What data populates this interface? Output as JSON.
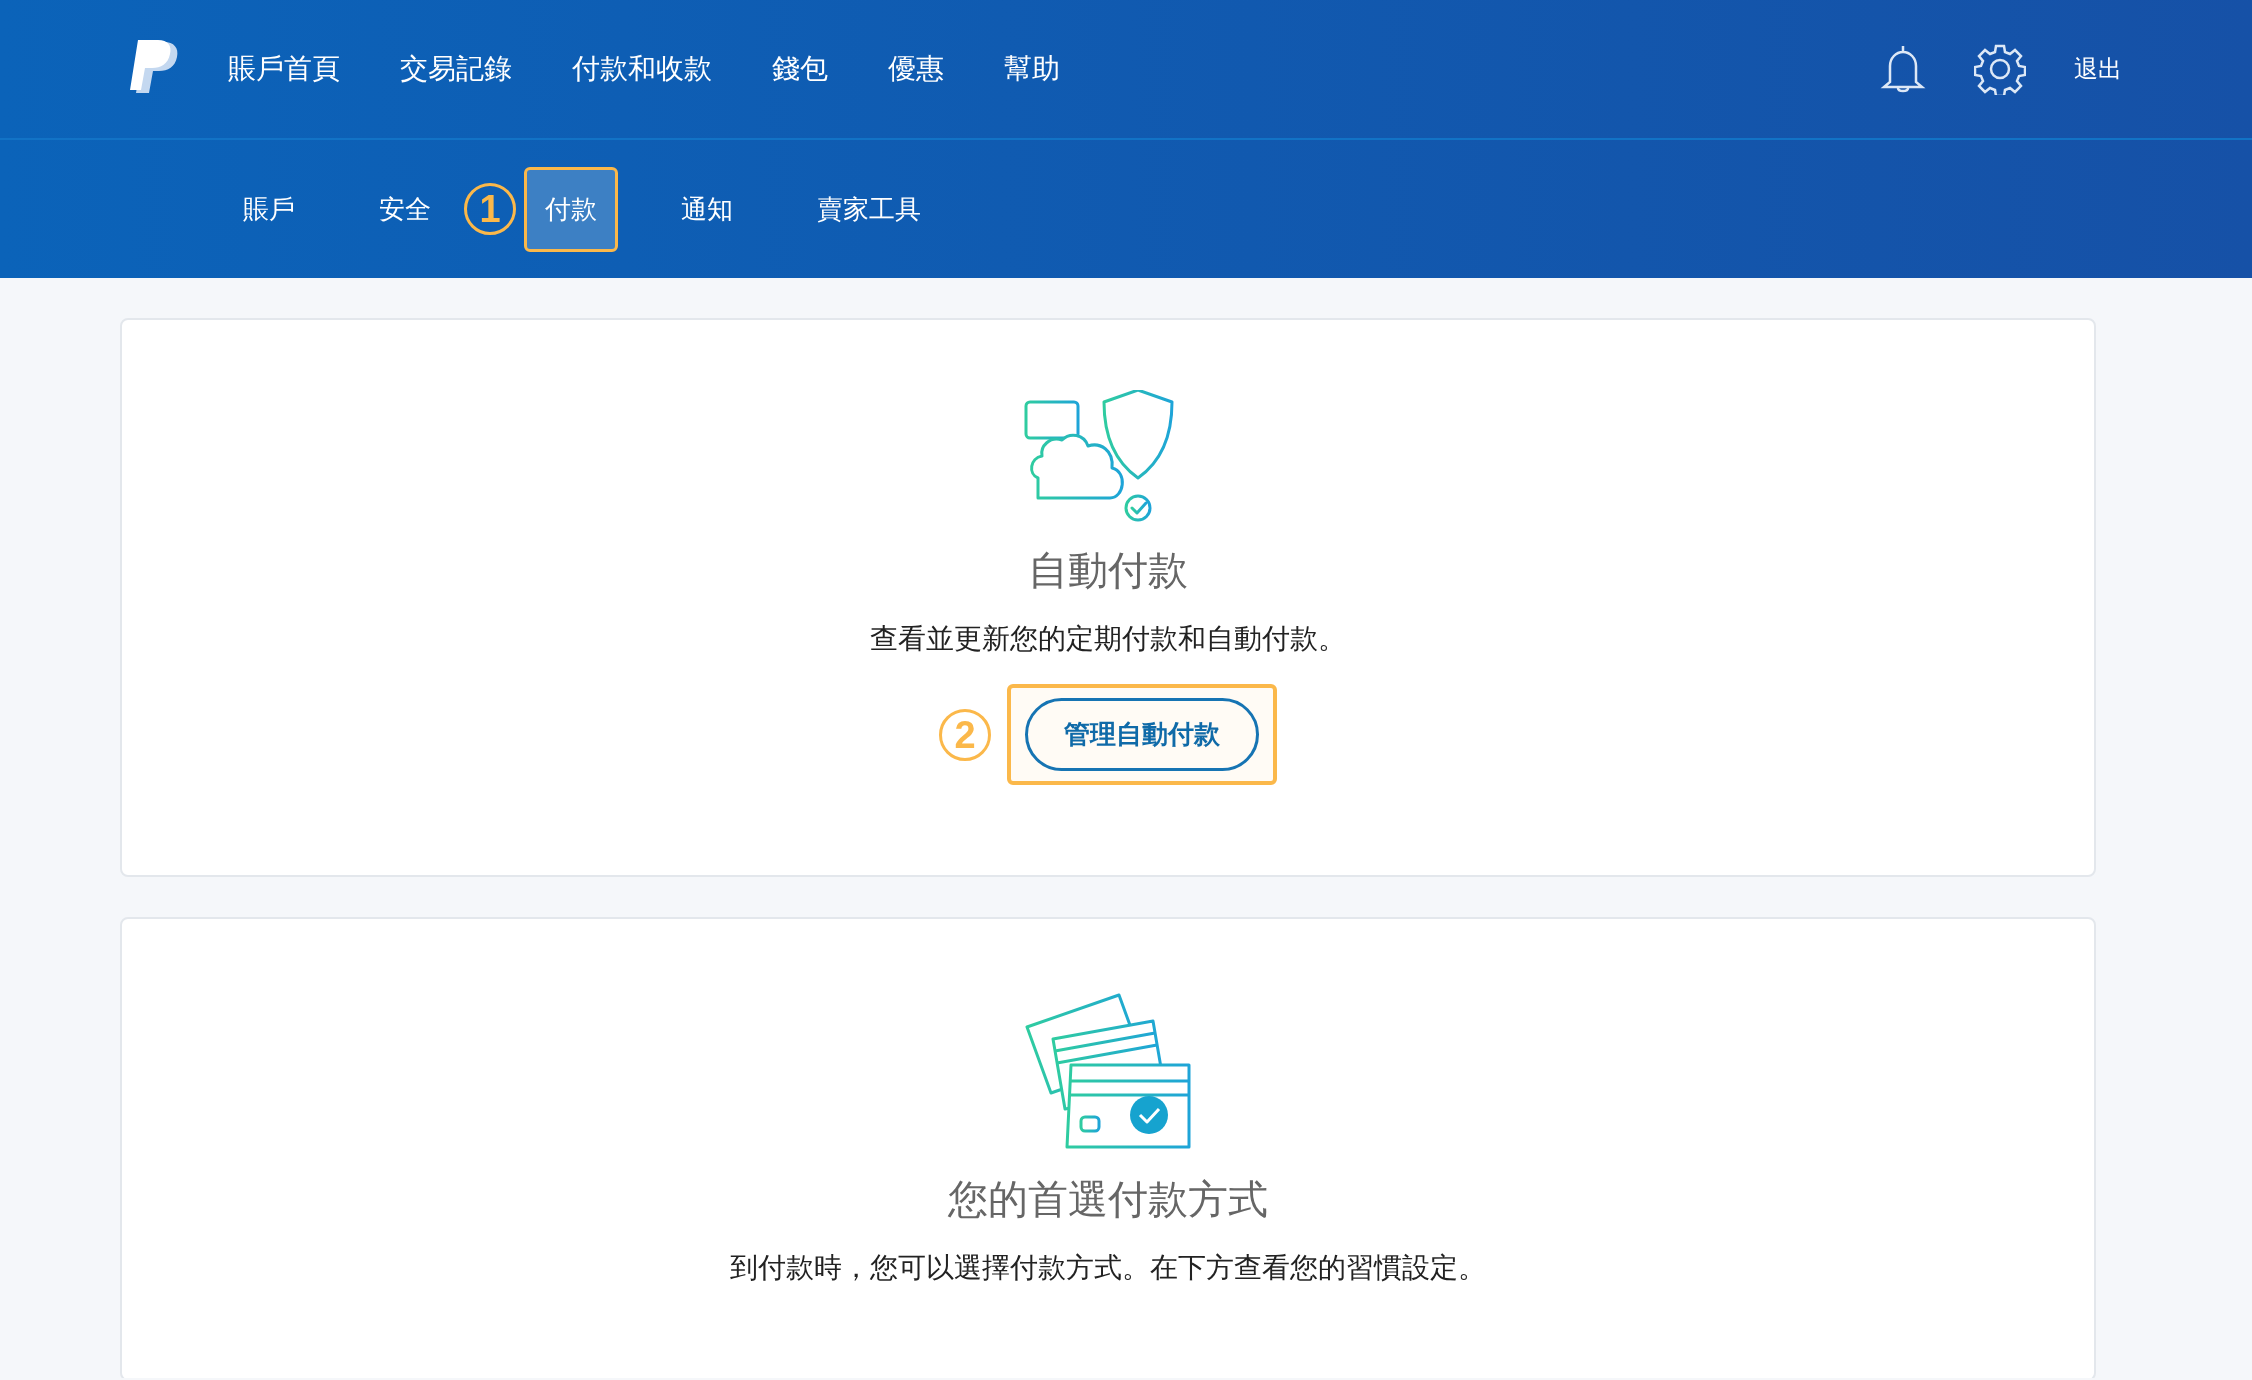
{
  "top_nav": {
    "items": [
      "賬戶首頁",
      "交易記錄",
      "付款和收款",
      "錢包",
      "優惠",
      "幫助"
    ],
    "logout": "退出"
  },
  "sub_nav": {
    "tabs": [
      {
        "label": "賬戶",
        "selected": false,
        "highlighted": false
      },
      {
        "label": "安全",
        "selected": false,
        "highlighted": false
      },
      {
        "label": "付款",
        "selected": true,
        "highlighted": true,
        "callout": "1"
      },
      {
        "label": "通知",
        "selected": false,
        "highlighted": false
      },
      {
        "label": "賣家工具",
        "selected": false,
        "highlighted": false
      }
    ]
  },
  "cards": [
    {
      "kind": "autopay",
      "title": "自動付款",
      "description": "查看並更新您的定期付款和自動付款。",
      "button": {
        "label": "管理自動付款",
        "highlighted": true,
        "callout": "2"
      }
    },
    {
      "kind": "payment-methods",
      "title": "您的首選付款方式",
      "description": "到付款時，您可以選擇付款方式。在下方查看您的習慣設定。"
    }
  ]
}
